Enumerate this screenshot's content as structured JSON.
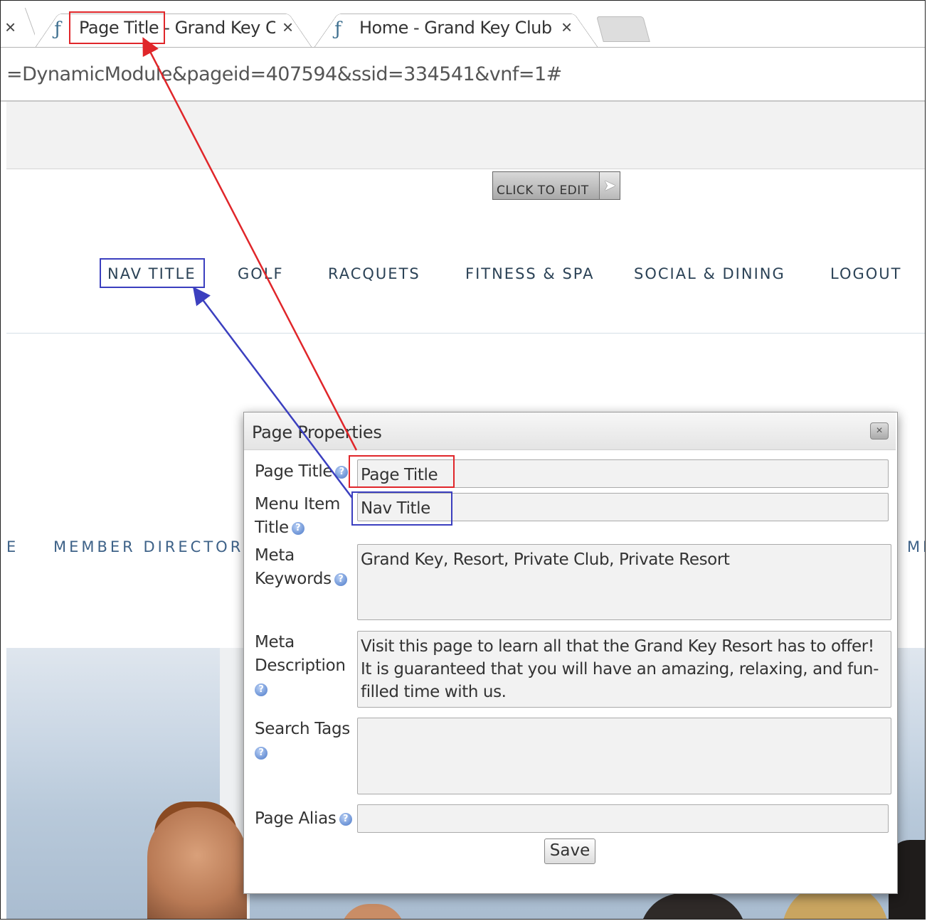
{
  "browser": {
    "tabs": [
      {
        "label": "Page Title - Grand Key Cl",
        "close": "×"
      },
      {
        "label": "Home - Grand Key Club",
        "close": "×"
      }
    ],
    "prev_tab_close": "×",
    "url": "=DynamicModule&pageid=407594&ssid=334541&vnf=1#"
  },
  "editor": {
    "click_to_edit": "CLICK TO EDIT"
  },
  "nav": {
    "items": [
      "NAV TITLE",
      "GOLF",
      "RACQUETS",
      "FITNESS & SPA",
      "SOCIAL & DINING",
      "LOGOUT"
    ]
  },
  "subnav": {
    "left_fragment": "E",
    "member_directory": "MEMBER DIRECTOR",
    "right_fragment": "MI"
  },
  "dialog": {
    "title": "Page Properties",
    "close": "×",
    "fields": {
      "page_title": {
        "label": "Page Title",
        "value": "Page Title"
      },
      "menu_item_title": {
        "label_line1": "Menu Item",
        "label_line2": "Title",
        "value": "Nav Title"
      },
      "meta_keywords": {
        "label_line1": "Meta",
        "label_line2": "Keywords",
        "value": "Grand Key, Resort, Private Club, Private Resort"
      },
      "meta_description": {
        "label_line1": "Meta",
        "label_line2": "Description",
        "value": "Visit this page to learn all that the Grand Key Resort has to offer! It is guaranteed that you will have an amazing, relaxing, and fun-filled time with us."
      },
      "search_tags": {
        "label": "Search Tags",
        "value": ""
      },
      "page_alias": {
        "label": "Page Alias",
        "value": ""
      }
    },
    "help_glyph": "?",
    "save_label": "Save"
  },
  "annotation_colors": {
    "page_title": "#e0262a",
    "nav_title": "#3b3fbf"
  }
}
